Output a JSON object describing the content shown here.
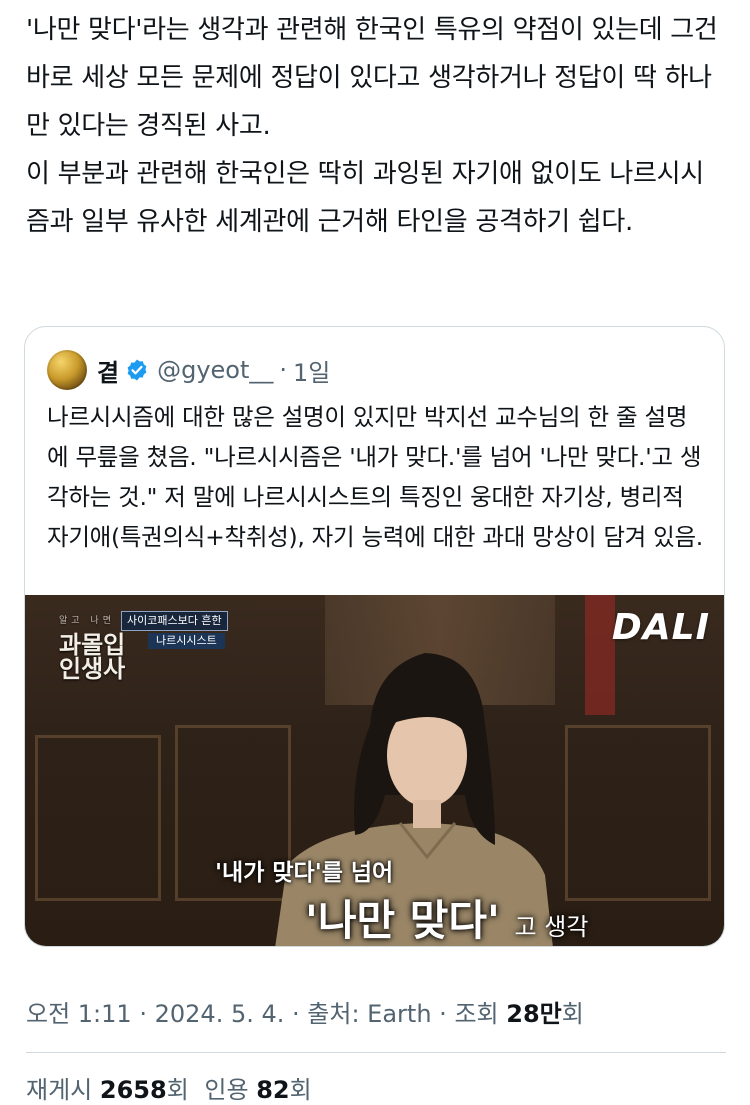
{
  "tweet": {
    "text": "'나만 맞다'라는 생각과 관련해 한국인 특유의 약점이 있는데 그건 바로 세상 모든 문제에 정답이 있다고 생각하거나 정답이 딱 하나만 있다는 경직된 사고.\n이 부분과 관련해 한국인은 딱히 과잉된 자기애 없이도 나르시시즘과 일부 유사한 세계관에 근거해 타인을 공격하기 쉽다."
  },
  "quote": {
    "name": "곁",
    "handle": "@gyeot__",
    "dot": "·",
    "time": "1일",
    "text": "나르시시즘에 대한 많은 설명이 있지만 박지선 교수님의 한 줄 설명에 무릎을 쳤음. \"나르시시즘은 '내가 맞다.'를 넘어 '나만 맞다.'고 생각하는 것.\" 저 말에 나르시시스트의 특징인 웅대한 자기상, 병리적 자기애(특권의식+착취성), 자기 능력에 대한 과대 망상이 담겨 있음.",
    "media": {
      "show_small": "알고 나면 쓸데없는",
      "show_line1": "과몰입",
      "show_line2": "인생사",
      "tag1": "사이코패스보다 흔한",
      "tag2": "나르시시스트",
      "channel": "DALI",
      "subtitle1": "'내가 맞다'를 넘어",
      "subtitle2_main": "'나만 맞다'",
      "subtitle2_tail": "고 생각"
    }
  },
  "meta": {
    "time": "오전 1:11",
    "sep1": "·",
    "date": "2024. 5. 4.",
    "sep2": "·",
    "source": "출처: Earth",
    "sep3": "·",
    "views_label": "조회",
    "views_count": "28만",
    "views_suffix": "회"
  },
  "stats": {
    "retweets_label": "재게시",
    "retweets_count": "2658",
    "retweets_suffix": "회",
    "quotes_label": "인용",
    "quotes_count": "82",
    "quotes_suffix": "회"
  },
  "colors": {
    "verified": "#1d9bf0",
    "secondary_text": "#536471",
    "border": "#cfd9de"
  }
}
